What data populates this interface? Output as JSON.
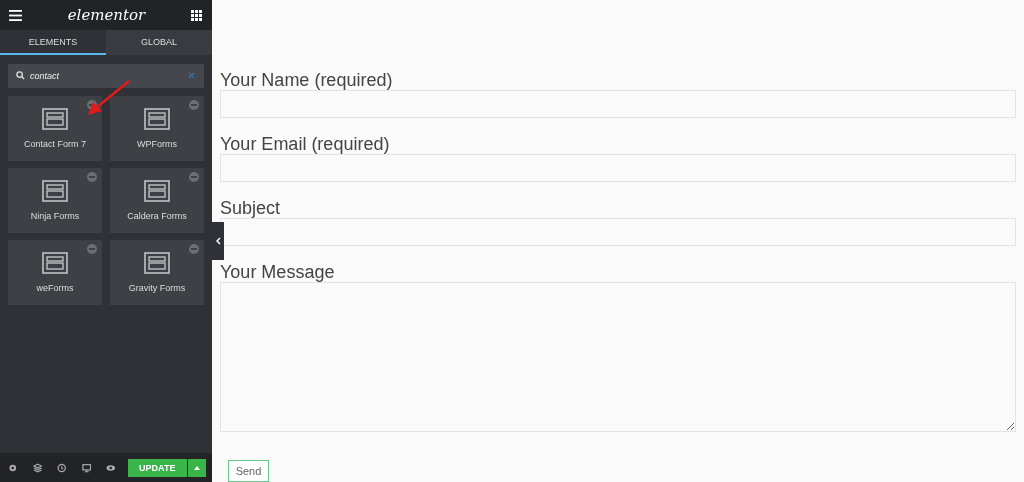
{
  "sidebar": {
    "logo": "elementor",
    "tabs": [
      {
        "label": "ELEMENTS",
        "selected": true
      },
      {
        "label": "GLOBAL",
        "selected": false
      }
    ],
    "search": {
      "value": "contact"
    },
    "widgets": [
      {
        "label": "Contact Form 7"
      },
      {
        "label": "WPForms"
      },
      {
        "label": "Ninja Forms"
      },
      {
        "label": "Caldera Forms"
      },
      {
        "label": "weForms"
      },
      {
        "label": "Gravity Forms"
      }
    ],
    "footer": {
      "update_button": "UPDATE"
    }
  },
  "form": {
    "fields": [
      {
        "label": "Your Name (required)",
        "kind": "input"
      },
      {
        "label": "Your Email (required)",
        "kind": "input"
      },
      {
        "label": "Subject",
        "kind": "input"
      },
      {
        "label": "Your Message",
        "kind": "textarea"
      }
    ],
    "submit": "Send"
  }
}
